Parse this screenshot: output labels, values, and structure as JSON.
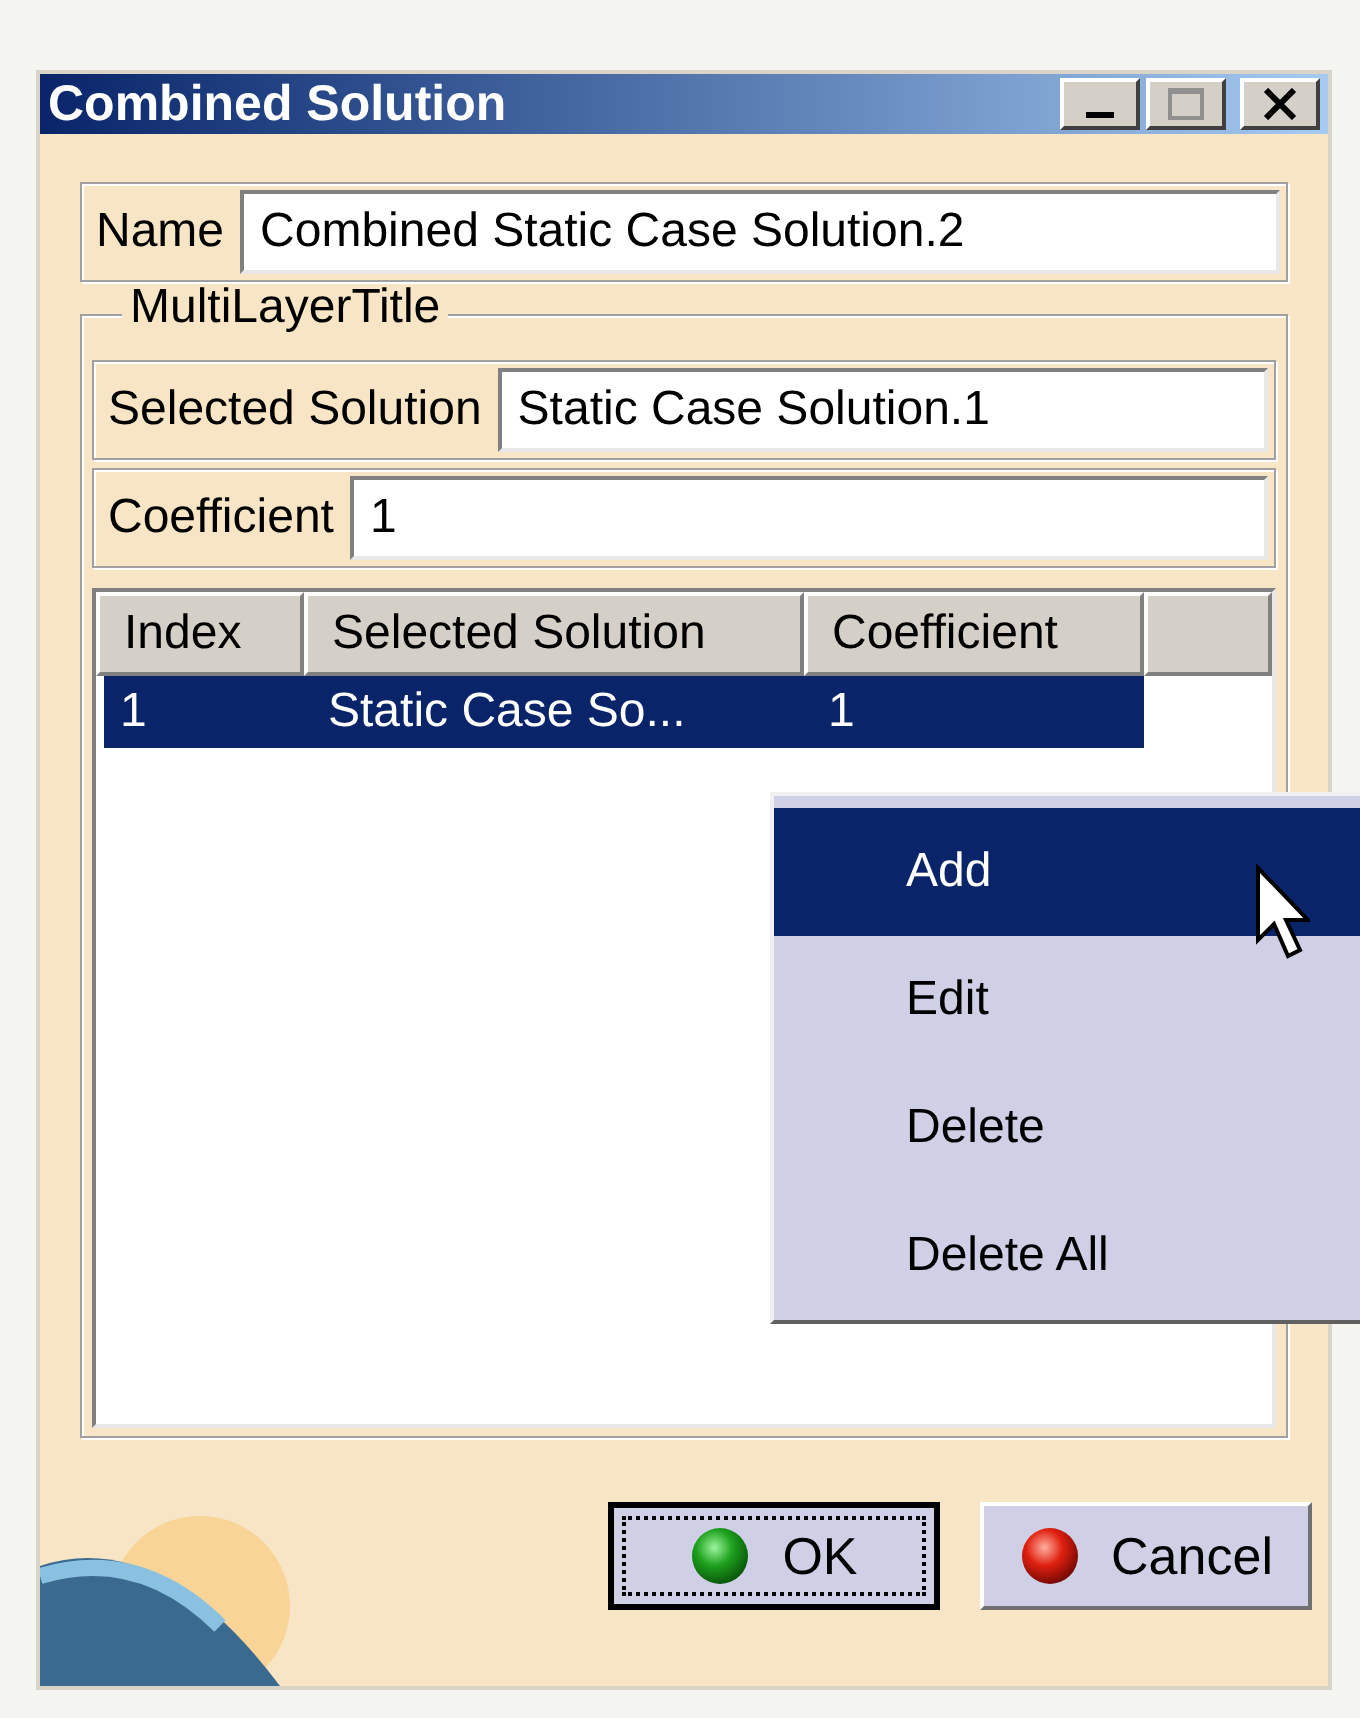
{
  "window": {
    "title": "Combined Solution"
  },
  "name_field": {
    "label": "Name",
    "value": "Combined Static Case Solution.2"
  },
  "group": {
    "title": "MultiLayerTitle",
    "selected_solution": {
      "label": "Selected Solution",
      "value": "Static Case Solution.1"
    },
    "coefficient": {
      "label": "Coefficient",
      "value": "1"
    },
    "table": {
      "columns": [
        "Index",
        "Selected Solution",
        "Coefficient"
      ],
      "rows": [
        {
          "cells": [
            "1",
            "Static Case So...",
            "1"
          ],
          "selected": true
        }
      ]
    }
  },
  "context_menu": {
    "items": [
      {
        "label": "Add",
        "selected": true
      },
      {
        "label": "Edit",
        "selected": false
      },
      {
        "label": "Delete",
        "selected": false
      },
      {
        "label": "Delete All",
        "selected": false
      }
    ]
  },
  "buttons": [
    {
      "kind": "ok",
      "label": "OK",
      "focused": true
    },
    {
      "kind": "cancel",
      "label": "Cancel",
      "focused": false
    }
  ]
}
